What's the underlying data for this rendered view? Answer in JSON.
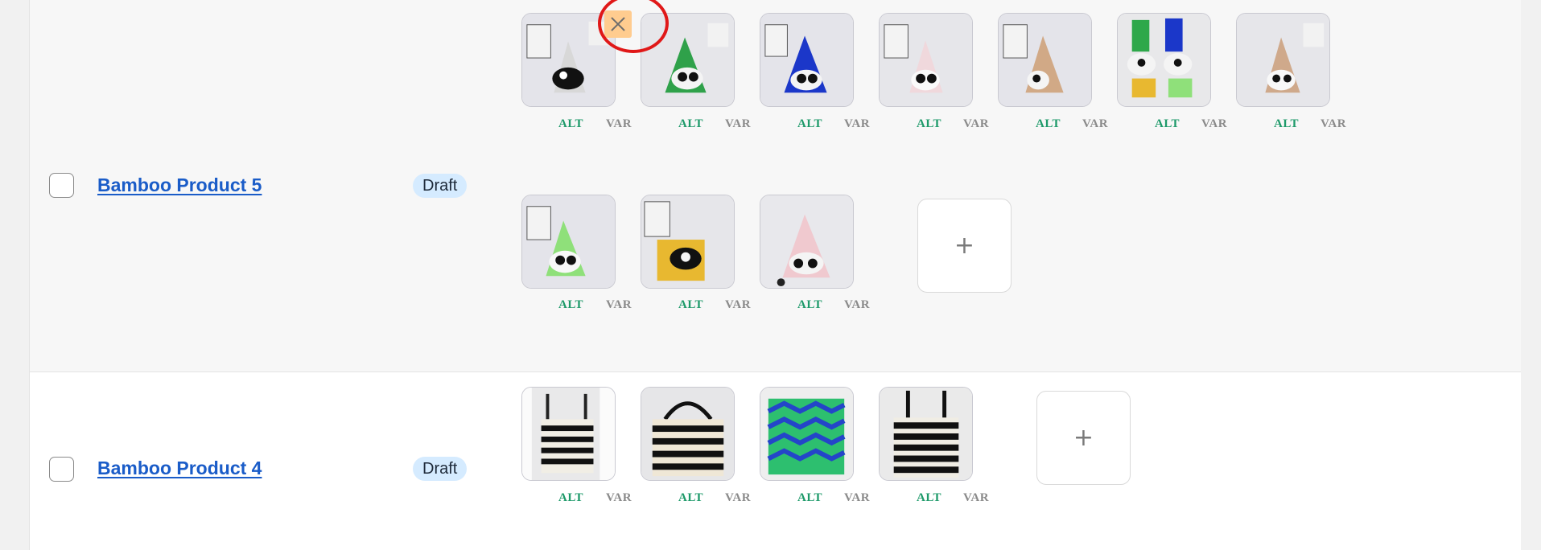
{
  "products": [
    {
      "title": "Bamboo Product 5",
      "status": "Draft",
      "alt_label": "ALT",
      "var_label": "VAR",
      "images": [
        "white-black-panda-tote",
        "green-panda-tote",
        "blue-panda-tote",
        "pink-panda-tote",
        "tan-panda-tote",
        "multicolor-panda-totes",
        "beige-panda-tote",
        "lime-panda-tote",
        "yellow-panda-tote",
        "pink-gray-panda-tote"
      ],
      "add_label": "+"
    },
    {
      "title": "Bamboo Product 4",
      "status": "Draft",
      "alt_label": "ALT",
      "var_label": "VAR",
      "images": [
        "black-white-striped-tote",
        "black-cream-striped-tote",
        "green-blue-chevron-tote",
        "black-striped-tote"
      ],
      "add_label": "+"
    }
  ],
  "delete_button": {
    "icon": "close-icon",
    "highlight_color": "#e01818"
  },
  "colors": {
    "link": "#1a5cc8",
    "alt": "#1e9a6a",
    "var": "#8a8a8a",
    "badge_bg": "#d5ebff",
    "delete_bg": "#ffcc8f"
  }
}
